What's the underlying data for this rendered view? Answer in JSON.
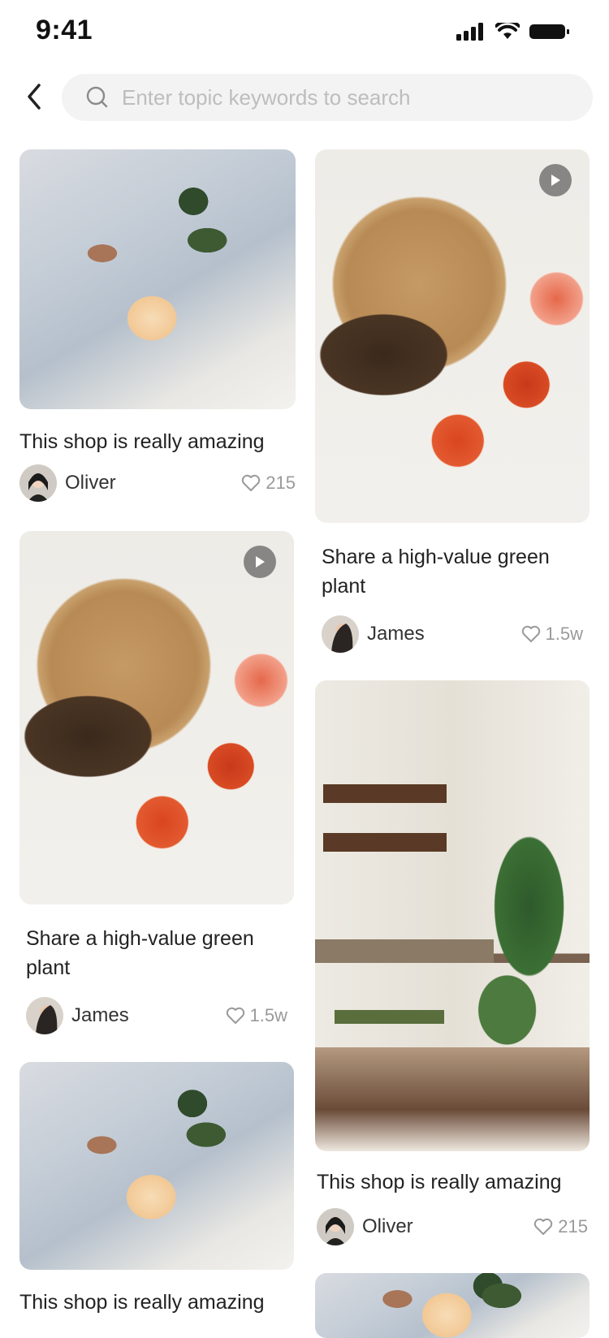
{
  "status_bar": {
    "time": "9:41"
  },
  "search": {
    "placeholder": "Enter topic keywords to search",
    "value": ""
  },
  "cards": [
    {
      "title": "This shop is really amazing",
      "author": "Oliver",
      "likes": "215",
      "image": "rose-on-book",
      "video": false
    },
    {
      "title": "Share a high-value green plant",
      "author": "James",
      "likes": "1.5w",
      "image": "straw-hat-and-grapefruit",
      "video": true
    },
    {
      "title": "Share a high-value green plant",
      "author": "James",
      "likes": "1.5w",
      "image": "straw-hat-and-grapefruit",
      "video": true
    },
    {
      "title": "This shop is really amazing",
      "author": "Oliver",
      "likes": "215",
      "image": "room-with-plants",
      "video": false
    },
    {
      "title": "This shop is really amazing",
      "author": "",
      "likes": "",
      "image": "rose-on-book",
      "video": false
    }
  ],
  "colors": {
    "text": "#222222",
    "muted": "#9a9a9a",
    "search_bg": "#f3f3f3"
  }
}
